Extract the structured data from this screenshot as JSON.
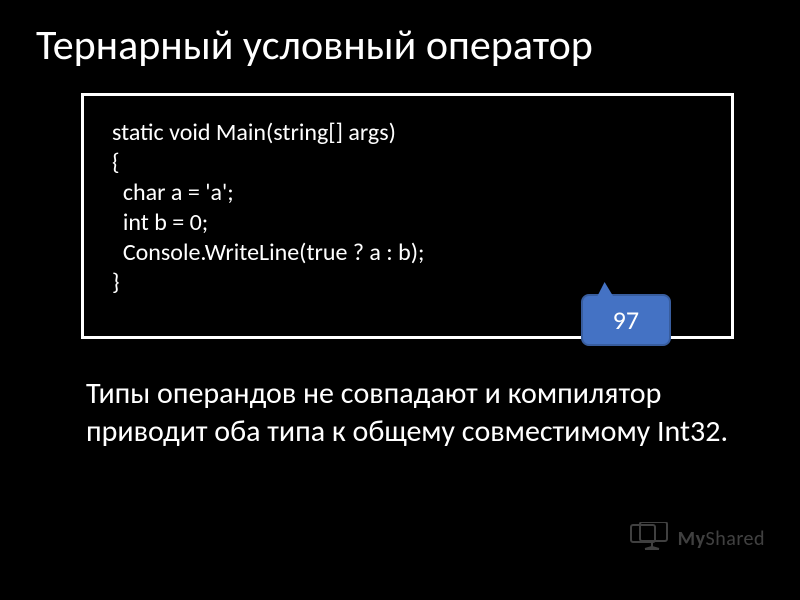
{
  "title": "Тернарный условный оператор",
  "code": "static void Main(string[] args)\n{\n  char a = 'a';\n  int b = 0;\n  Console.WriteLine(true ? a : b);\n}",
  "callout": "97",
  "explanation": "Типы операндов не совпадают и компилятор приводит оба типа к общему совместимому Int32.",
  "watermark": {
    "brand_prefix": "My",
    "brand_rest": "Shared"
  }
}
